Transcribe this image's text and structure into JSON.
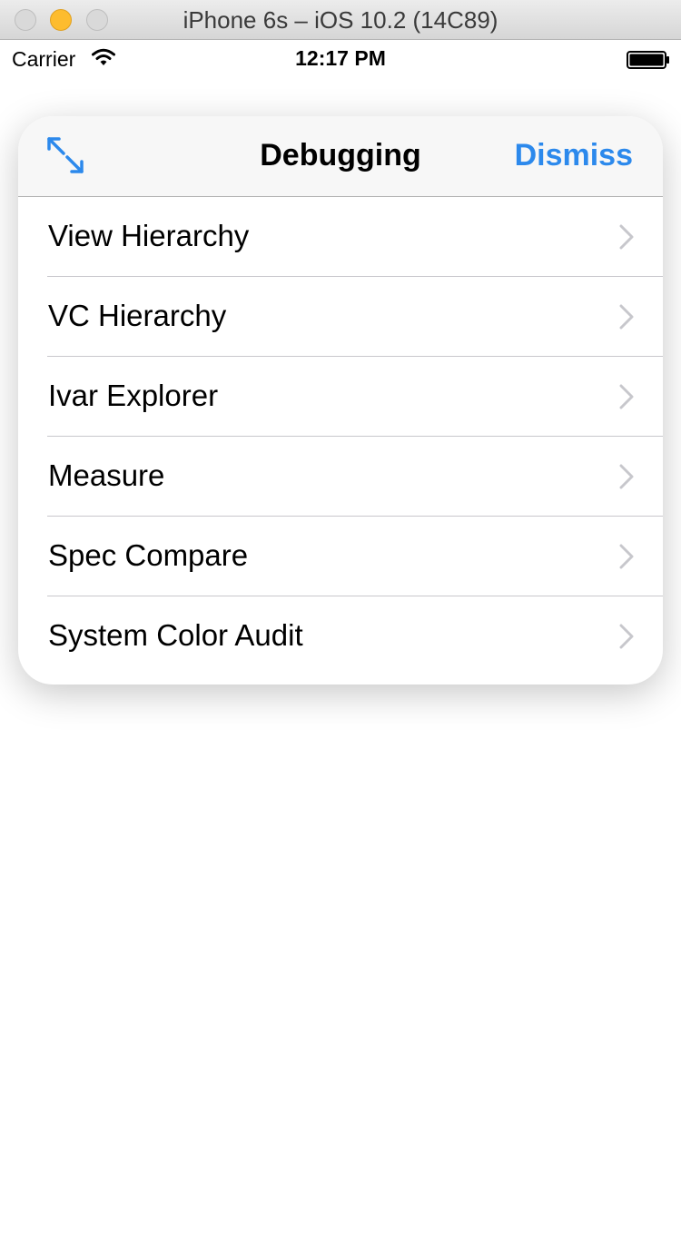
{
  "window": {
    "title": "iPhone 6s – iOS 10.2 (14C89)"
  },
  "status_bar": {
    "carrier": "Carrier",
    "time": "12:17 PM"
  },
  "panel": {
    "title": "Debugging",
    "dismiss_label": "Dismiss",
    "accent_color": "#2c89ec",
    "items": [
      {
        "label": "View Hierarchy"
      },
      {
        "label": "VC Hierarchy"
      },
      {
        "label": "Ivar Explorer"
      },
      {
        "label": "Measure"
      },
      {
        "label": "Spec Compare"
      },
      {
        "label": "System Color Audit"
      }
    ]
  },
  "icons": {
    "expand": "expand-icon",
    "chevron": "chevron-right-icon",
    "wifi": "wifi-icon",
    "battery": "battery-icon"
  }
}
